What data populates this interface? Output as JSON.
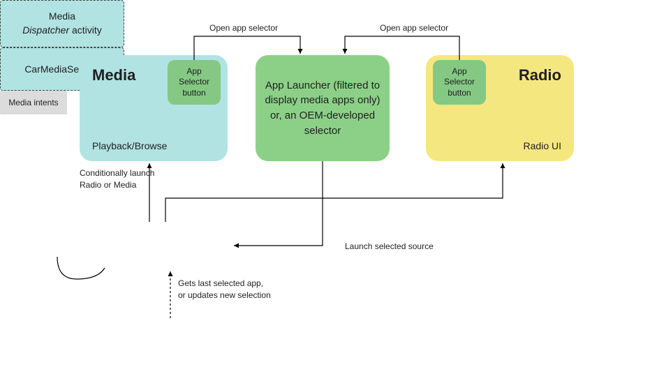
{
  "media": {
    "title": "Media",
    "subtitle": "Playback/Browse",
    "selector_button": "App Selector button"
  },
  "launcher": {
    "text": "App Launcher (filtered to display media apps only) or, an OEM-developed selector"
  },
  "radio": {
    "title": "Radio",
    "subtitle": "Radio UI",
    "selector_button": "App Selector button"
  },
  "dispatcher": {
    "line1": "Media",
    "line2_italic": "Dispatcher",
    "line2_rest": " activity"
  },
  "car_service": {
    "label": "CarMediaService"
  },
  "intents": {
    "label": "Media intents"
  },
  "labels": {
    "open_selector_1": "Open app selector",
    "open_selector_2": "Open app selector",
    "conditional_launch": "Conditionally launch Radio or Media",
    "launch_selected": "Launch selected source",
    "gets_last": "Gets last selected app, or updates new selection"
  },
  "colors": {
    "media_bg": "#b0e3e2",
    "launcher_bg": "#8cd088",
    "radio_bg": "#f5e77f",
    "selector_btn_bg": "#84c884",
    "intents_bg": "#dcdcdc"
  }
}
